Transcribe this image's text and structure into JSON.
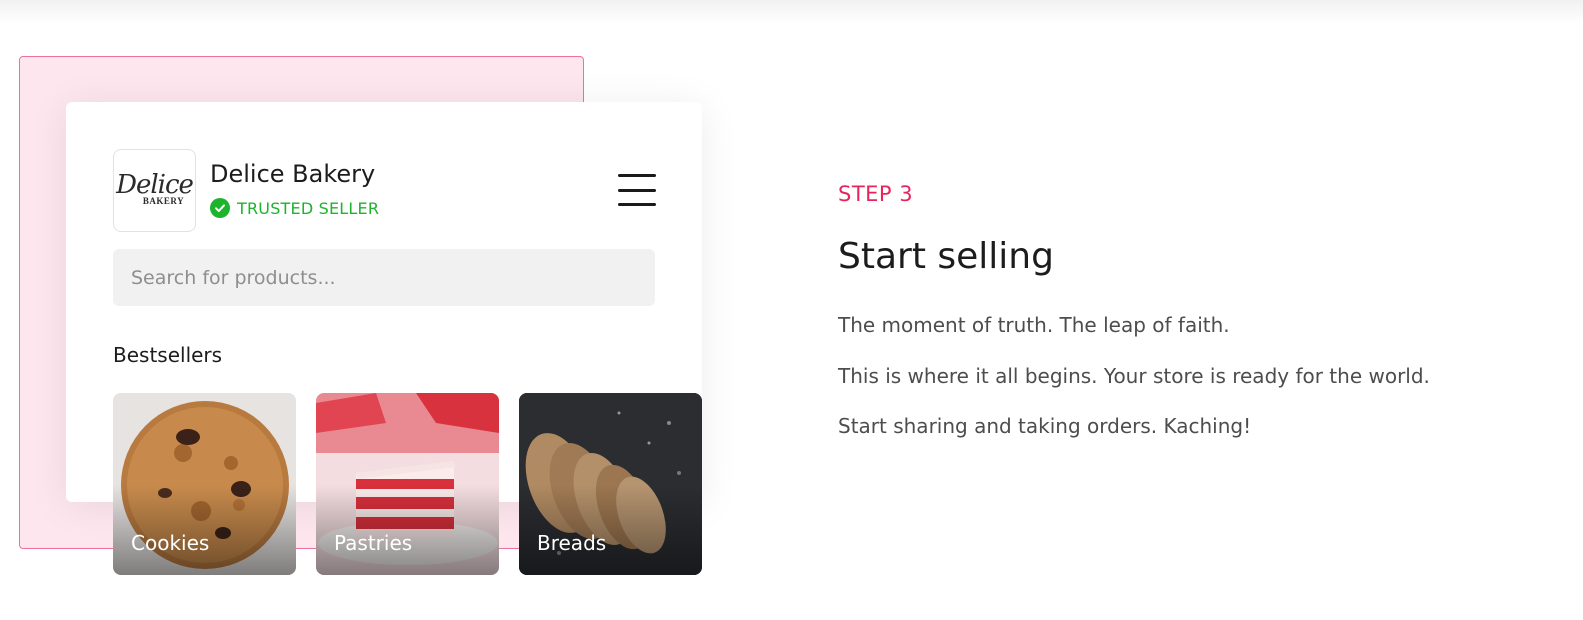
{
  "store": {
    "logo": {
      "script_text": "Delice",
      "word_text": "BAKERY"
    },
    "name": "Delice Bakery",
    "badge": "TRUSTED SELLER"
  },
  "search": {
    "placeholder": "Search for products..."
  },
  "section": {
    "title": "Bestsellers"
  },
  "categories": [
    {
      "label": "Cookies"
    },
    {
      "label": "Pastries"
    },
    {
      "label": "Breads"
    }
  ],
  "content": {
    "step": "STEP 3",
    "heading": "Start selling",
    "paragraphs": [
      "The moment of truth. The leap of faith.",
      "This is where it all begins. Your store is ready for the world.",
      "Start sharing and taking orders. Kaching!"
    ]
  },
  "colors": {
    "accent_pink": "#e8245f",
    "trusted_green": "#1db32c",
    "frame_pink": "#fde6ee"
  },
  "icons": {
    "badge": "check-circle-icon",
    "menu": "hamburger-menu-icon"
  }
}
